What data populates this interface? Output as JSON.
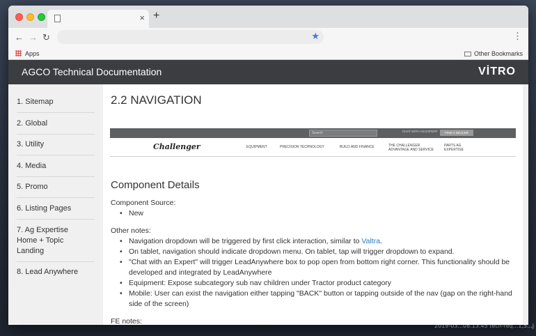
{
  "browser": {
    "tab_title": "",
    "tab_close": "×",
    "new_tab": "+",
    "back": "←",
    "forward": "→",
    "reload": "↻",
    "star": "★",
    "menu": "⋮",
    "url": ""
  },
  "bookmarks": {
    "apps": "Apps",
    "other": "Other Bookmarks"
  },
  "site": {
    "title": "AGCO Technical Documentation",
    "logo": "VİTRO"
  },
  "sidebar": {
    "items": [
      {
        "label": "1. Sitemap"
      },
      {
        "label": "2. Global"
      },
      {
        "label": "3. Utility"
      },
      {
        "label": "4. Media"
      },
      {
        "label": "5. Promo"
      },
      {
        "label": "6. Listing Pages"
      },
      {
        "label": "7. Ag Expertise Home + Topic Landing"
      },
      {
        "label": "8. Lead Anywhere"
      }
    ]
  },
  "main": {
    "title": "2.2 NAVIGATION",
    "preview": {
      "search": "Search",
      "chat": "CHAT WITH AN EXPERT",
      "dealer": "FIND A DEALER",
      "logo": "Challenger",
      "nav": [
        "EQUIPMENT",
        "PRECISION TECHNOLOGY",
        "BUILD AND FINANCE",
        "THE CHALLENGER ADVANTAGE AND SERVICE",
        "PARTS AG EXPERTISE"
      ]
    },
    "component_heading": "Component Details",
    "source_label": "Component Source:",
    "source_items": [
      "New"
    ],
    "notes_label": "Other notes:",
    "notes": [
      {
        "text": "Navigation dropdown will be triggered by first click interaction, similar to ",
        "link": "Valtra",
        "after": "."
      },
      {
        "text": "On tablet, navigation should indicate dropdown menu. On tablet, tap will trigger dropdown to expand."
      },
      {
        "text": "\"Chat with an Expert\" will trigger LeadAnywhere box to pop open from bottom right corner. This functionality should be developed and integrated by LeadAnywhere"
      },
      {
        "text": "Equipment: Expose subcategory sub nav children under Tractor product category"
      },
      {
        "text": "Mobile: User can exist the navigation either tapping \"BACK\" button or tapping outside of the nav (gap on the right-hand side of the screen)"
      }
    ],
    "fe_label": "FE notes:"
  },
  "desktop": {
    "snippet": "2019-03...08.13.45   tech-req...1,5...j"
  }
}
